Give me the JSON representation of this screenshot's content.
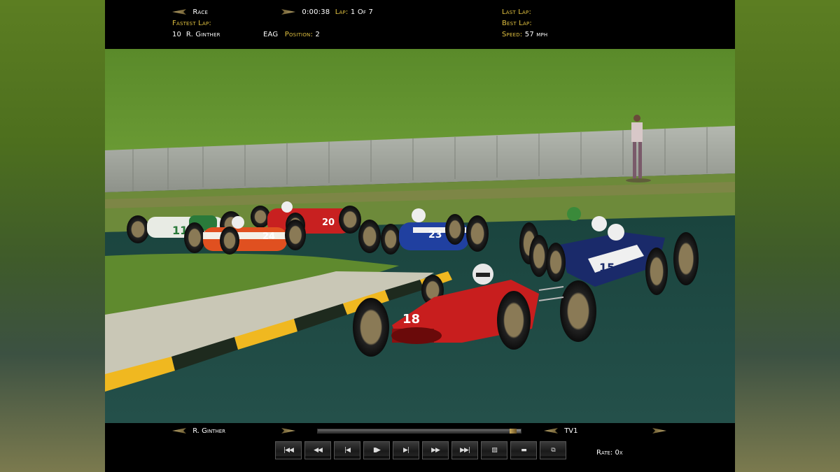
{
  "hud_top": {
    "race_label": "Race",
    "time": "0:00:38",
    "lap_label": "Lap:",
    "lap_value": "1 Of 7",
    "fastest_lap_label": "Fastest Lap:",
    "fastest_lap_value": "10  R. Ginther",
    "driver_code": "EAG",
    "position_label": "Position:",
    "position_value": "2",
    "last_lap_label": "Last Lap:",
    "best_lap_label": "Best Lap:",
    "speed_label": "Speed:",
    "speed_value": "57 mph"
  },
  "scene": {
    "cars": [
      {
        "number": "18",
        "color": "#c81e1e"
      },
      {
        "number": "15",
        "color": "#1a2a6a"
      },
      {
        "number": "23",
        "color": "#2040a0"
      },
      {
        "number": "20",
        "color": "#c82020"
      },
      {
        "number": "24",
        "color": "#e05020"
      },
      {
        "number": "11",
        "color": "#2a7a3a"
      }
    ],
    "colors": {
      "grass": "#5f8a2e",
      "track": "#1e4a44",
      "wall": "#a8aca4",
      "kerb_yellow": "#f0b820",
      "kerb_dark": "#1e2a1e"
    }
  },
  "hud_bottom": {
    "driver_name": "R. Ginther",
    "camera": "TV1",
    "rate_label": "Rate:",
    "rate_value": "0x",
    "progress_fraction": 0.98,
    "controls": [
      {
        "name": "skip-to-start-button",
        "glyph": "|◀◀"
      },
      {
        "name": "rewind-button",
        "glyph": "◀◀"
      },
      {
        "name": "step-back-button",
        "glyph": "|◀"
      },
      {
        "name": "play-pause-button",
        "glyph": "▮▶"
      },
      {
        "name": "step-forward-button",
        "glyph": "▶|"
      },
      {
        "name": "fast-forward-button",
        "glyph": "▶▶"
      },
      {
        "name": "skip-to-end-button",
        "glyph": "▶▶|"
      },
      {
        "name": "record-button",
        "glyph": "▨"
      },
      {
        "name": "folder-button",
        "glyph": "▬"
      },
      {
        "name": "copy-button",
        "glyph": "⧉"
      }
    ]
  }
}
